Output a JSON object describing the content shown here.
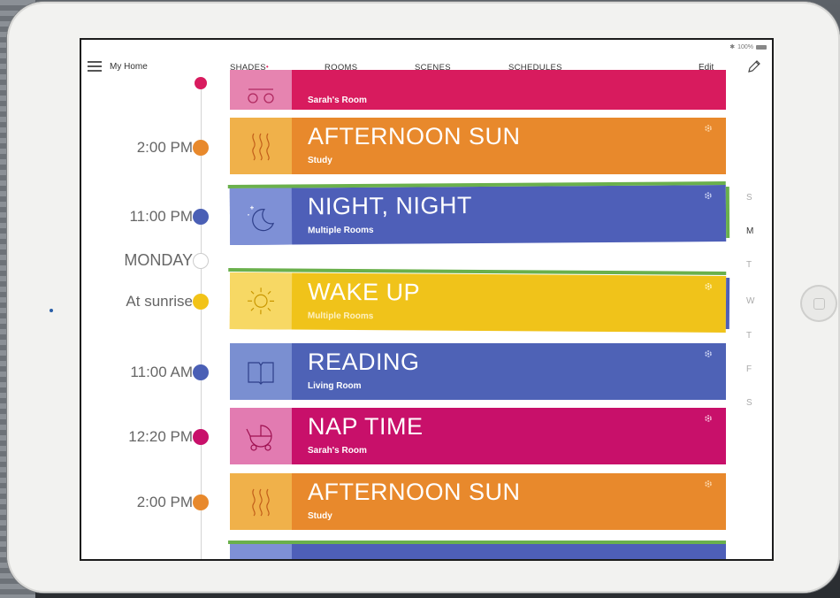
{
  "status": {
    "bluetooth": "✱",
    "battery_pct": "100%"
  },
  "header": {
    "title": "My Home",
    "tabs": [
      {
        "label": "SHADES",
        "has_dot": true
      },
      {
        "label": "ROOMS"
      },
      {
        "label": "SCENES"
      },
      {
        "label": "SCHEDULES"
      }
    ],
    "edit_label": "Edit"
  },
  "timeline": {
    "entries": [
      {
        "time": "2:00 PM",
        "dot_color": "#e8892c"
      },
      {
        "time": "11:00 PM",
        "dot_color": "#4a5fb5"
      },
      {
        "time": "MONDAY",
        "dot_color": "#ffffff"
      },
      {
        "time": "At sunrise",
        "dot_color": "#f2c318"
      },
      {
        "time": "11:00 AM",
        "dot_color": "#4a5fb5"
      },
      {
        "time": "12:20 PM",
        "dot_color": "#c8106a"
      },
      {
        "time": "2:00 PM",
        "dot_color": "#e8892c"
      }
    ]
  },
  "scenes": [
    {
      "title": "",
      "sub": "Sarah's Room",
      "icon": "baby-carriage-icon",
      "color": "#d81b5e",
      "icon_bg": "#e684b0"
    },
    {
      "title": "AFTERNOON SUN",
      "sub": "Study",
      "icon": "heat-waves-icon",
      "color": "#e8892c",
      "icon_bg": "#f0b14a"
    },
    {
      "title": "NIGHT, NIGHT",
      "sub": "Multiple Rooms",
      "icon": "moon-stars-icon",
      "color": "#4e5fb8",
      "icon_bg": "#7e90d6"
    },
    {
      "title": "WAKE UP",
      "sub": "Multiple Rooms",
      "icon": "sun-icon",
      "color": "#f0c31a",
      "icon_bg": "#f7d864"
    },
    {
      "title": "READING",
      "sub": "Living Room",
      "icon": "book-icon",
      "color": "#4e62b6",
      "icon_bg": "#7a8fd1"
    },
    {
      "title": "NAP TIME",
      "sub": "Sarah's Room",
      "icon": "baby-carriage-icon",
      "color": "#c8106a",
      "icon_bg": "#e27bb1"
    },
    {
      "title": "AFTERNOON SUN",
      "sub": "Study",
      "icon": "heat-waves-icon",
      "color": "#e8892c",
      "icon_bg": "#f0b14a"
    }
  ],
  "weekdays": [
    "S",
    "M",
    "T",
    "W",
    "T",
    "F",
    "S"
  ],
  "active_weekday": "M"
}
